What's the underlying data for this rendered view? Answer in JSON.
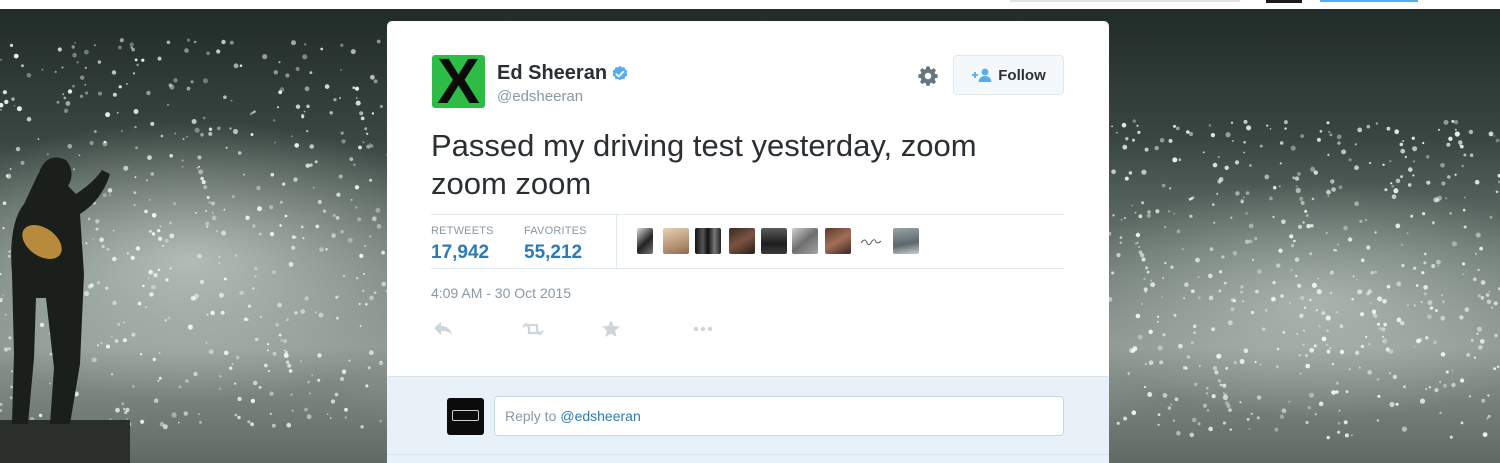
{
  "tweet": {
    "user": {
      "name": "Ed Sheeran",
      "handle": "@edsheeran",
      "avatar_glyph": "X",
      "avatar_color": "#2dbd46",
      "verified": true
    },
    "follow_label": "Follow",
    "text": "Passed my driving test yesterday, zoom zoom zoom",
    "stats": {
      "retweets_label": "RETWEETS",
      "retweets": "17,942",
      "favorites_label": "FAVORITES",
      "favorites": "55,212"
    },
    "timestamp": "4:09 AM - 30 Oct 2015",
    "actions": [
      "reply-icon",
      "retweet-icon",
      "favorite-icon",
      "more-icon"
    ],
    "favoriters_count_shown": 9
  },
  "reply": {
    "prefix": "Reply to",
    "mention": "@edsheeran"
  },
  "colors": {
    "link_blue": "#2b7bb9",
    "verified_blue": "#55acee",
    "muted_gray": "#8899a6",
    "reply_bg": "#e8f1f8"
  }
}
